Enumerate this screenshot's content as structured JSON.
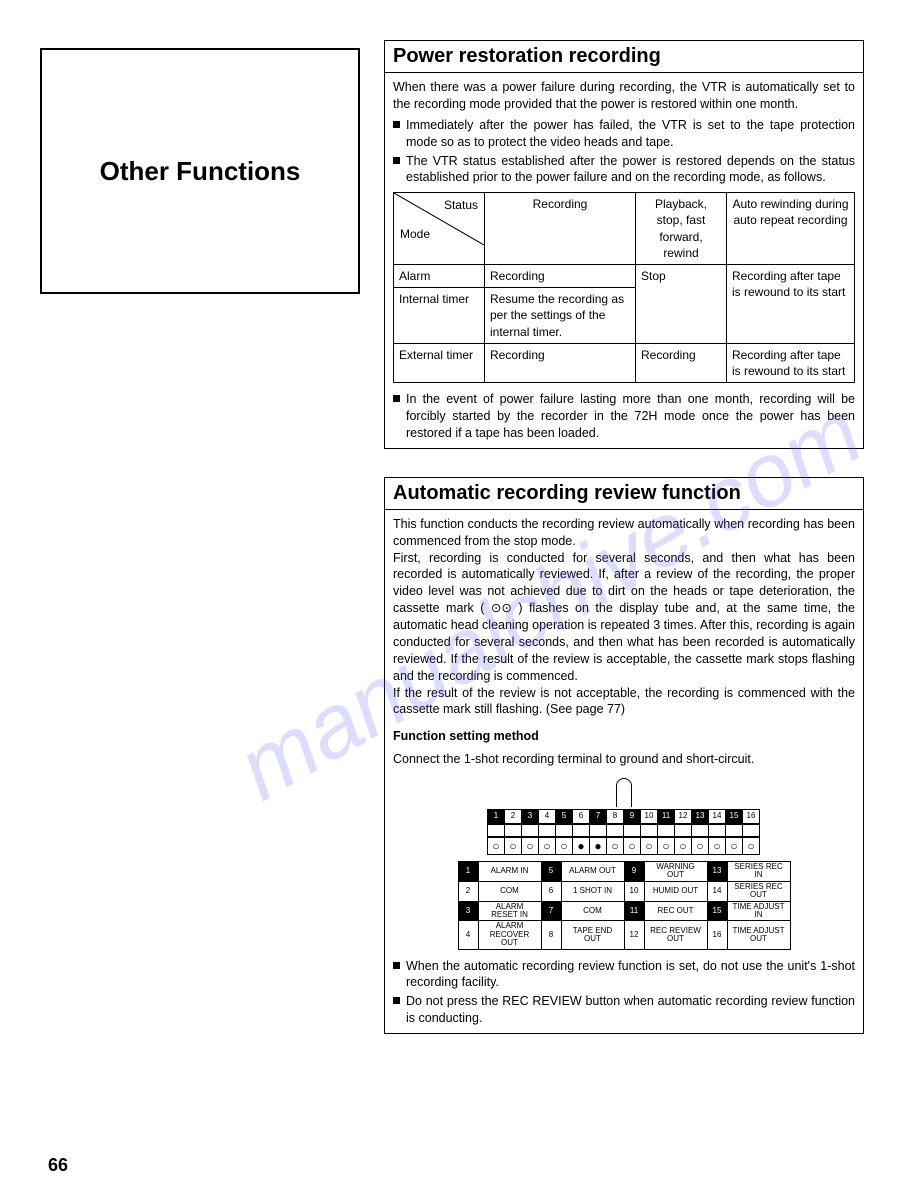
{
  "page_number": "66",
  "left_title": "Other Functions",
  "watermark_text": "manualchive.com",
  "section1": {
    "title": "Power restoration recording",
    "intro": "When there was a power failure during recording, the VTR is automatically set to the recording mode provided that the power is restored within one month.",
    "bullet1": "Immediately after the power has failed, the VTR is set to the tape protection mode so as to protect the video heads and tape.",
    "bullet2": "The VTR status established after the power is restored depends on the status established prior to the power failure and on the recording mode, as follows.",
    "table": {
      "corner_status": "Status",
      "corner_mode": "Mode",
      "col1": "Recording",
      "col2": "Playback, stop, fast forward, rewind",
      "col3": "Auto rewinding during auto repeat recording",
      "row1_mode": "Alarm",
      "row1_c1": "Recording",
      "row1_c2": "Stop",
      "row1_c3": "Recording after tape is rewound to its start",
      "row2_mode": "Internal timer",
      "row2_c1": "Resume the recording as per the settings of the internal timer.",
      "row3_mode": "External timer",
      "row3_c1": "Recording",
      "row3_c2": "Recording",
      "row3_c3": "Recording after tape is rewound to its start"
    },
    "after_bullet": "In the event of power failure lasting more than one month, recording will be forcibly started by the recorder in the 72H mode once the power has been restored if a tape has been loaded."
  },
  "section2": {
    "title": "Automatic recording review function",
    "p1": "This function conducts the recording review automatically when recording has been commenced from the stop mode.",
    "p2": "First, recording is conducted for several seconds, and then what has been recorded is automatically reviewed. If, after a review of the recording, the proper video level was not achieved due to dirt on the heads or tape deterioration, the cassette mark ( ⊙⊙ ) flashes on the display tube and, at the same time, the automatic head cleaning operation is repeated 3 times. After this, recording is again conducted for several seconds, and then what has been recorded is automatically reviewed. If the result of the review is acceptable, the cassette mark stops flashing and the recording is commenced.",
    "p3": "If the result of the review is not acceptable, the recording is commenced with the cassette mark still flashing. (See page 77)",
    "sub_heading": "Function setting method",
    "connect_text": "Connect the 1-shot recording terminal to ground and short-circuit.",
    "legend": {
      "r1": [
        "1",
        "ALARM IN",
        "5",
        "ALARM OUT",
        "9",
        "WARNING OUT",
        "13",
        "SERIES REC IN"
      ],
      "r2": [
        "2",
        "COM",
        "6",
        "1 SHOT IN",
        "10",
        "HUMID OUT",
        "14",
        "SERIES REC OUT"
      ],
      "r3": [
        "3",
        "ALARM RESET IN",
        "7",
        "COM",
        "11",
        "REC OUT",
        "15",
        "TIME ADJUST IN"
      ],
      "r4": [
        "4",
        "ALARM RECOVER OUT",
        "8",
        "TAPE END OUT",
        "12",
        "REC REVIEW OUT",
        "16",
        "TIME ADJUST OUT"
      ]
    },
    "end_bullet1": "When the automatic recording review function is set, do not use the unit's 1-shot recording facility.",
    "end_bullet2": "Do not press the REC REVIEW button when automatic recording review function is conducting."
  }
}
